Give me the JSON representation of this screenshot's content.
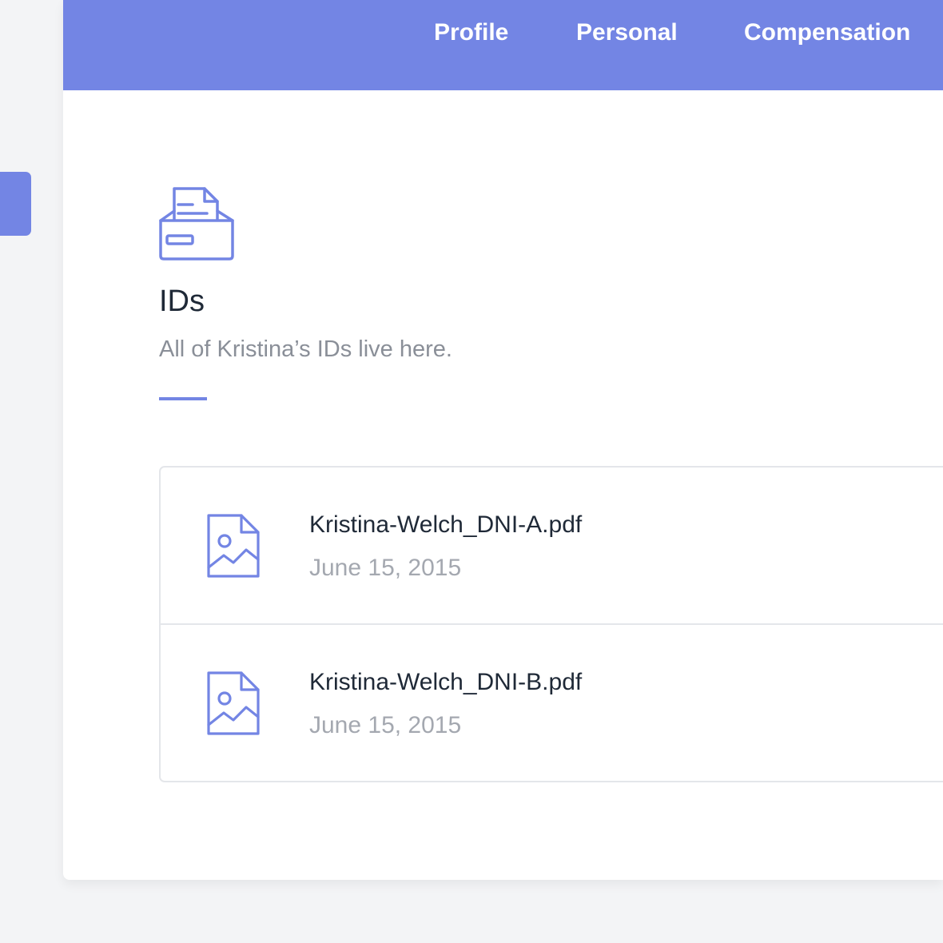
{
  "colors": {
    "accent": "#7385e4",
    "background": "#f3f4f6",
    "card": "#ffffff",
    "text_primary": "#1f2937",
    "text_secondary": "#8a8f98",
    "text_muted": "#a4a8b0"
  },
  "header": {
    "tabs": [
      {
        "label": "Profile"
      },
      {
        "label": "Personal"
      },
      {
        "label": "Compensation"
      }
    ]
  },
  "section": {
    "icon": "inbox-tray-icon",
    "title": "IDs",
    "subtitle": "All of Kristina’s IDs live here."
  },
  "files": [
    {
      "name": "Kristina-Welch_DNI-A.pdf",
      "date": "June 15, 2015",
      "icon": "image-file-icon"
    },
    {
      "name": "Kristina-Welch_DNI-B.pdf",
      "date": "June 15, 2015",
      "icon": "image-file-icon"
    }
  ]
}
